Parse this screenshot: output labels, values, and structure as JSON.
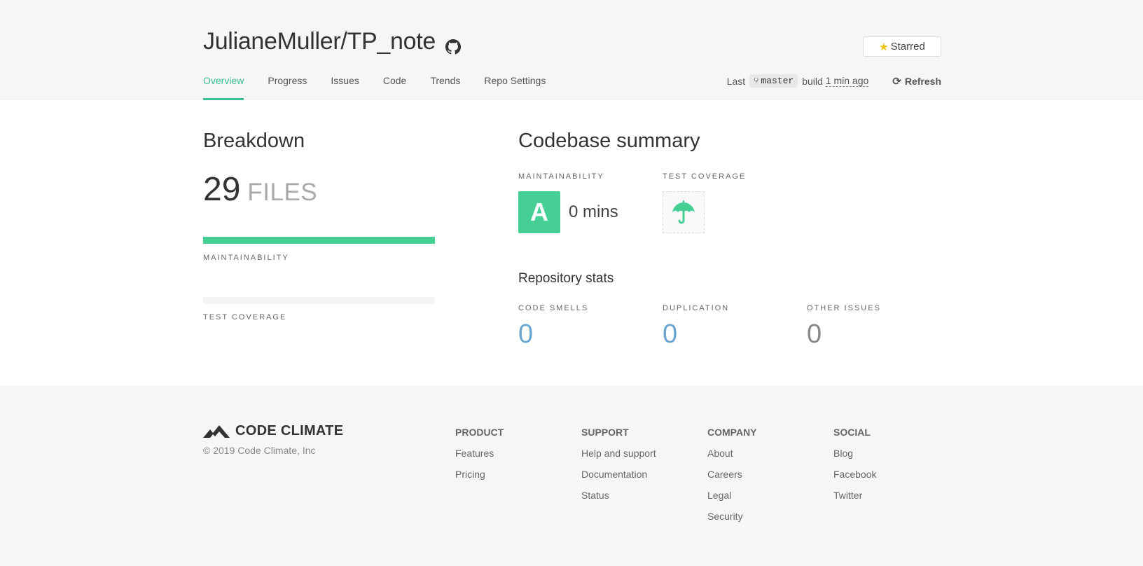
{
  "header": {
    "repo_name": "JulianeMuller/TP_note",
    "starred_label": "Starred",
    "nav": [
      "Overview",
      "Progress",
      "Issues",
      "Code",
      "Trends",
      "Repo Settings"
    ],
    "active_nav": "Overview",
    "build": {
      "prefix": "Last",
      "branch": "master",
      "mid": "build",
      "time": "1 min ago"
    },
    "refresh_label": "Refresh"
  },
  "breakdown": {
    "title": "Breakdown",
    "files_count": "29",
    "files_label": "FILES",
    "maintainability_label": "MAINTAINABILITY",
    "maintainability_fill": 1.0,
    "test_coverage_label": "TEST COVERAGE",
    "test_coverage_fill": 0
  },
  "summary": {
    "title": "Codebase summary",
    "maintainability_label": "MAINTAINABILITY",
    "grade": "A",
    "remediation": "0 mins",
    "test_coverage_label": "TEST COVERAGE",
    "stats_title": "Repository stats",
    "stats": [
      {
        "label": "CODE SMELLS",
        "value": "0"
      },
      {
        "label": "DUPLICATION",
        "value": "0"
      },
      {
        "label": "OTHER ISSUES",
        "value": "0"
      }
    ]
  },
  "footer": {
    "brand": "CODE CLIMATE",
    "copyright": "© 2019 Code Climate, Inc",
    "columns": [
      {
        "title": "PRODUCT",
        "links": [
          "Features",
          "Pricing"
        ]
      },
      {
        "title": "SUPPORT",
        "links": [
          "Help and support",
          "Documentation",
          "Status"
        ]
      },
      {
        "title": "COMPANY",
        "links": [
          "About",
          "Careers",
          "Legal",
          "Security"
        ]
      },
      {
        "title": "SOCIAL",
        "links": [
          "Blog",
          "Facebook",
          "Twitter"
        ]
      }
    ]
  },
  "colors": {
    "accent": "#46cf95",
    "link_blue": "#6aa6cf",
    "star": "#f4c20d"
  }
}
